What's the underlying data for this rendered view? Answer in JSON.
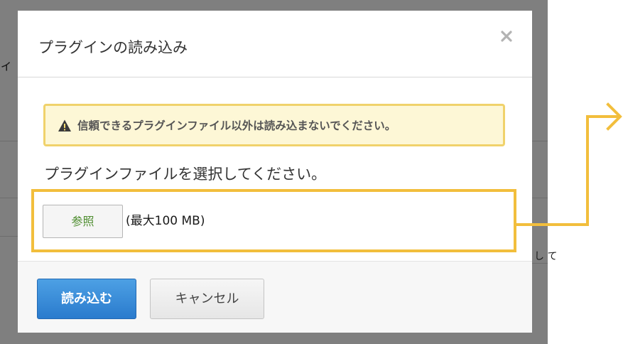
{
  "background": {
    "fragment_left": "ィ",
    "fragment_right": "し て"
  },
  "dialog": {
    "title": "プラグインの読み込み",
    "close_icon": "close-icon",
    "warning": {
      "icon": "warning-triangle-icon",
      "text": "信頼できるプラグインファイル以外は読み込まないでください。"
    },
    "select_label": "プラグインファイルを選択してください。",
    "browse_label": "参照",
    "max_size": "(最大100 MB)",
    "import_label": "読み込む",
    "cancel_label": "キャンセル"
  },
  "colors": {
    "accent_highlight": "#f2be3c",
    "primary_button": "#2a7bcd",
    "warning_border": "#f0d26b",
    "browse_text": "#4e8d2f"
  }
}
